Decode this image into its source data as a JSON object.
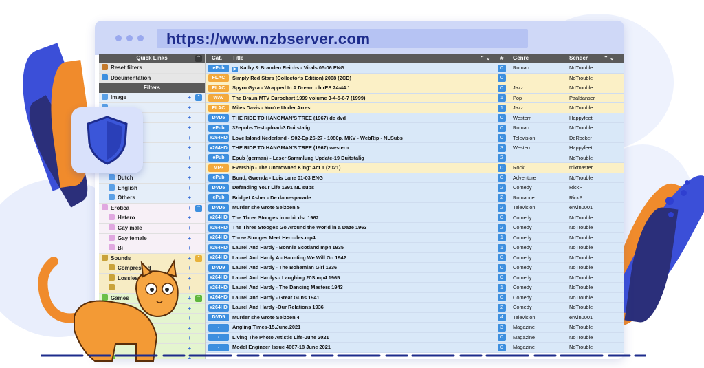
{
  "browser": {
    "url": "https://www.nzbserver.com"
  },
  "sidebar": {
    "quick_links_label": "Quick Links",
    "quick_links": [
      {
        "label": "Reset filters",
        "icon": "home-icon"
      },
      {
        "label": "Documentation",
        "icon": "help-icon"
      }
    ],
    "filters_label": "Filters",
    "filters": [
      {
        "label": "Image",
        "style": "row-blue",
        "indent": 0
      },
      {
        "label": "",
        "style": "row-blue",
        "indent": 0
      },
      {
        "label": "",
        "style": "row-blue",
        "indent": 0
      },
      {
        "label": "",
        "style": "row-blue",
        "indent": 0
      },
      {
        "label": "",
        "style": "row-blue",
        "indent": 0
      },
      {
        "label": "",
        "style": "row-blue",
        "indent": 0
      },
      {
        "label": "",
        "style": "row-blue",
        "indent": 0
      },
      {
        "label": "",
        "style": "row-blue",
        "indent": 0
      },
      {
        "label": "Dutch",
        "style": "row-blue",
        "indent": 1
      },
      {
        "label": "English",
        "style": "row-blue",
        "indent": 1
      },
      {
        "label": "Others",
        "style": "row-blue",
        "indent": 1
      },
      {
        "label": "Erotica",
        "style": "row-pink",
        "indent": 0
      },
      {
        "label": "Hetero",
        "style": "row-pink",
        "indent": 1
      },
      {
        "label": "Gay male",
        "style": "row-pink",
        "indent": 1
      },
      {
        "label": "Gay female",
        "style": "row-pink",
        "indent": 1
      },
      {
        "label": "Bi",
        "style": "row-pink",
        "indent": 1
      },
      {
        "label": "Sounds",
        "style": "row-yellow",
        "indent": 0
      },
      {
        "label": "Compressed",
        "style": "row-yellow",
        "indent": 1
      },
      {
        "label": "Lossless",
        "style": "row-yellow",
        "indent": 1
      },
      {
        "label": "",
        "style": "row-yellow",
        "indent": 1
      },
      {
        "label": "Games",
        "style": "row-green",
        "indent": 0
      },
      {
        "label": "Windo",
        "style": "row-green",
        "indent": 1
      },
      {
        "label": "",
        "style": "row-green",
        "indent": 1
      },
      {
        "label": "",
        "style": "row-green",
        "indent": 1
      },
      {
        "label": "",
        "style": "row-green",
        "indent": 1
      },
      {
        "label": "",
        "style": "row-green",
        "indent": 1
      },
      {
        "label": "",
        "style": "row-green",
        "indent": 1
      }
    ]
  },
  "table": {
    "headers": {
      "cat": "Cat.",
      "title": "Title",
      "num": "#",
      "genre": "Genre",
      "sender": "Sender"
    },
    "rows": [
      {
        "cat": "ePub",
        "color": "b",
        "title": "Kathy & Branden Reichs - Virals 05-06 ENG",
        "num": "0",
        "genre": "Roman",
        "sender": "NoTrouble",
        "row": "blue",
        "play": true
      },
      {
        "cat": "FLAC",
        "color": "o",
        "title": "Simply Red Stars (Collector's Edition) 2008 (2CD)",
        "num": "0",
        "genre": "",
        "sender": "NoTrouble",
        "row": "yellow"
      },
      {
        "cat": "FLAC",
        "color": "o",
        "title": "Spyro Gyra - Wrapped In A Dream - hirES 24-44.1",
        "num": "0",
        "genre": "Jazz",
        "sender": "NoTrouble",
        "row": "yellow"
      },
      {
        "cat": "WAV",
        "color": "o",
        "title": "The Braun MTV Eurochart 1999 volume 3-4-5-6-7 (1999)",
        "num": "1",
        "genre": "Pop",
        "sender": "Paaldanser",
        "row": "yellow"
      },
      {
        "cat": "FLAC",
        "color": "o",
        "title": "Miles Davis - You're Under Arrest",
        "num": "1",
        "genre": "Jazz",
        "sender": "NoTrouble",
        "row": "yellow"
      },
      {
        "cat": "DVD5",
        "color": "b",
        "title": "THE RIDE TO HANGMAN'S TREE (1967) de dvd",
        "num": "0",
        "genre": "Western",
        "sender": "Happyfeet",
        "row": "blue"
      },
      {
        "cat": "ePub",
        "color": "b",
        "title": "32epubs Testupload-3 Duitstalig",
        "num": "0",
        "genre": "Roman",
        "sender": "NoTrouble",
        "row": "blue"
      },
      {
        "cat": "x264HD",
        "color": "b",
        "title": "Love Island Nederland - S02-Ep.26-27 - 1080p. MKV - WebRip - NLSubs",
        "num": "0",
        "genre": "Television",
        "sender": "DeRocker",
        "row": "blue"
      },
      {
        "cat": "x264HD",
        "color": "b",
        "title": "THE RIDE TO HANGMAN'S TREE (1967) western",
        "num": "3",
        "genre": "Western",
        "sender": "Happyfeet",
        "row": "blue"
      },
      {
        "cat": "ePub",
        "color": "b",
        "title": "Epub (german) - Leser Sammlung Update-19 Duitstalig",
        "num": "2",
        "genre": "",
        "sender": "NoTrouble",
        "row": "blue"
      },
      {
        "cat": "MP3",
        "color": "o",
        "title": "Evership - The Uncrowned King: Act 1 (2021)",
        "num": "0",
        "genre": "Rock",
        "sender": "mixmaster",
        "row": "yellow"
      },
      {
        "cat": "ePub",
        "color": "b",
        "title": "Bond, Gwenda - Lois Lane 01-03 ENG",
        "num": "0",
        "genre": "Adventure",
        "sender": "NoTrouble",
        "row": "blue"
      },
      {
        "cat": "DVD5",
        "color": "b",
        "title": "Defending Your Life 1991 NL subs",
        "num": "2",
        "genre": "Comedy",
        "sender": "RickP",
        "row": "blue"
      },
      {
        "cat": "ePub",
        "color": "b",
        "title": "Bridget Asher - De damesparade",
        "num": "2",
        "genre": "Romance",
        "sender": "RickP",
        "row": "blue"
      },
      {
        "cat": "DVD5",
        "color": "b",
        "title": "Murder she wrote Seizoen 5",
        "num": "2",
        "genre": "Television",
        "sender": "erwin0001",
        "row": "blue"
      },
      {
        "cat": "x264HD",
        "color": "b",
        "title": "The Three Stooges in orbit dsr 1962",
        "num": "0",
        "genre": "Comedy",
        "sender": "NoTrouble",
        "row": "blue"
      },
      {
        "cat": "x264HD",
        "color": "b",
        "title": "The Three Stooges Go Around the World in a Daze 1963",
        "num": "2",
        "genre": "Comedy",
        "sender": "NoTrouble",
        "row": "blue"
      },
      {
        "cat": "x264HD",
        "color": "b",
        "title": "Three Stooges Meet Hercules.mp4",
        "num": "1",
        "genre": "Comedy",
        "sender": "NoTrouble",
        "row": "blue"
      },
      {
        "cat": "x264HD",
        "color": "b",
        "title": "Laurel And Hardy - Bonnie Scotland mp4 1935",
        "num": "1",
        "genre": "Comedy",
        "sender": "NoTrouble",
        "row": "blue"
      },
      {
        "cat": "x264HD",
        "color": "b",
        "title": "Laurel And Hardy A - Haunting We Will Go 1942",
        "num": "0",
        "genre": "Comedy",
        "sender": "NoTrouble",
        "row": "blue"
      },
      {
        "cat": "DVD9",
        "color": "b",
        "title": "Laurel And Hardy - The Bohemian Girl 1936",
        "num": "0",
        "genre": "Comedy",
        "sender": "NoTrouble",
        "row": "blue"
      },
      {
        "cat": "x264HD",
        "color": "b",
        "title": "Laurel And Hardys - Laughing 20S mp4 1965",
        "num": "0",
        "genre": "Comedy",
        "sender": "NoTrouble",
        "row": "blue"
      },
      {
        "cat": "x264HD",
        "color": "b",
        "title": "Laurel And Hardy - The Dancing Masters 1943",
        "num": "1",
        "genre": "Comedy",
        "sender": "NoTrouble",
        "row": "blue"
      },
      {
        "cat": "x264HD",
        "color": "b",
        "title": "Laurel And Hardy - Great Guns 1941",
        "num": "0",
        "genre": "Comedy",
        "sender": "NoTrouble",
        "row": "blue"
      },
      {
        "cat": "x264HD",
        "color": "b",
        "title": "Laurel And Hardy -Our Relations 1936",
        "num": "2",
        "genre": "Comedy",
        "sender": "NoTrouble",
        "row": "blue"
      },
      {
        "cat": "DVD5",
        "color": "b",
        "title": "Murder she wrote Seizoen 4",
        "num": "4",
        "genre": "Television",
        "sender": "erwin0001",
        "row": "blue"
      },
      {
        "cat": "-",
        "color": "b",
        "title": "Angling.Times-15.June.2021",
        "num": "3",
        "genre": "Magazine",
        "sender": "NoTrouble",
        "row": "blue"
      },
      {
        "cat": "-",
        "color": "b",
        "title": "Living The Photo Artistic Life-June 2021",
        "num": "0",
        "genre": "Magazine",
        "sender": "NoTrouble",
        "row": "blue"
      },
      {
        "cat": "-",
        "color": "b",
        "title": "Model Engineer Issue 4667-18 June 2021",
        "num": "0",
        "genre": "Magazine",
        "sender": "NoTrouble",
        "row": "blue"
      }
    ]
  }
}
